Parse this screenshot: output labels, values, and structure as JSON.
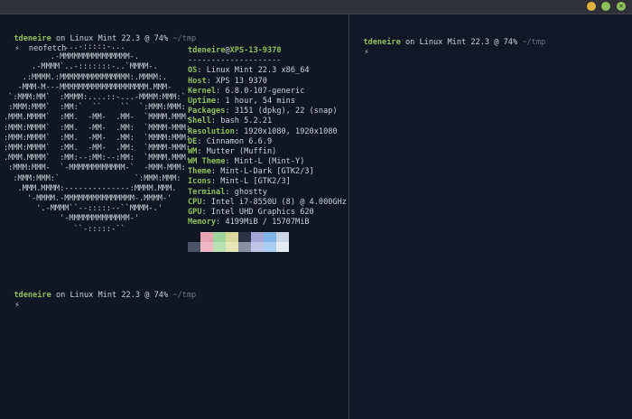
{
  "window": {
    "title": "",
    "controls": {
      "minimize": "",
      "maximize": "",
      "close": "✕"
    }
  },
  "left_pane": {
    "prompt1": {
      "user": "tdeneire",
      "on": " on ",
      "host": "Linux Mint 22.3",
      "at": " @ ",
      "battery": "74%",
      "path": " ~/tmp"
    },
    "command1": {
      "bolt": "⚡",
      "command": "neofetch"
    },
    "prompt2": {
      "user": "tdeneire",
      "on": " on ",
      "host": "Linux Mint 22.3",
      "at": " @ ",
      "battery": "74%",
      "path": " ~/tmp"
    },
    "command2": {
      "bolt": "⚡"
    }
  },
  "right_pane": {
    "prompt": {
      "user": "tdeneire",
      "on": " on ",
      "host": "Linux Mint 22.3",
      "at": " @ ",
      "battery": "74%",
      "path": " ~/tmp"
    },
    "command": {
      "bolt": "⚡"
    }
  },
  "neofetch": {
    "ascii_art": [
      "             ...-:::::-...",
      "          .-MMMMMMMMMMMMMMM-.",
      "      .-MMMM`..-:::::::-..`MMMM-.",
      "    .:MMMM.:MMMMMMMMMMMMMMM:.MMMM:.",
      "   -MMM-M---MMMMMMMMMMMMMMMMMMM.MMM-",
      " `:MMM:MM`  :MMMM:....::-...-MMMM:MMM:`",
      " :MMM:MMM`  :MM:`  ``    ``  `:MMM:MMM:",
      ".MMM.MMMM`  :MM.  -MM-  .MM-  `MMMM.MMM.",
      ":MMM:MMMM`  :MM.  -MM-  .MM:  `MMMM-MMM:",
      ":MMM:MMMM`  :MM.  -MM-  .MM:  `MMMM:MMM:",
      ":MMM:MMMM`  :MM.  -MM-  .MM:  `MMMM-MMM:",
      ".MMM.MMMM`  :MM:--:MM:--:MM:  `MMMM.MMM.",
      " :MMM:MMM-  `-MMMMMMMMMMMM-`  -MMM-MMM:",
      "  :MMM:MMM:`                `:MMM:MMM:",
      "   .MMM.MMMM:--------------:MMMM.MMM.",
      "     '-MMMM.-MMMMMMMMMMMMMMM-.MMMM-'",
      "       '.-MMMM``--:::::--``MMMM-.'",
      "            '-MMMMMMMMMMMMM-'",
      "               ``-:::::-``"
    ],
    "header": {
      "user": "tdeneire",
      "at": "@",
      "host": "XPS-13-9370",
      "separator": "--------------------"
    },
    "fields": [
      {
        "key": "OS",
        "value": "Linux Mint 22.3 x86_64"
      },
      {
        "key": "Host",
        "value": "XPS 13 9370"
      },
      {
        "key": "Kernel",
        "value": "6.8.0-107-generic"
      },
      {
        "key": "Uptime",
        "value": "1 hour, 54 mins"
      },
      {
        "key": "Packages",
        "value": "3151 (dpkg), 22 (snap)"
      },
      {
        "key": "Shell",
        "value": "bash 5.2.21"
      },
      {
        "key": "Resolution",
        "value": "1920x1080, 1920x1080"
      },
      {
        "key": "DE",
        "value": "Cinnamon 6.6.9"
      },
      {
        "key": "WM",
        "value": "Mutter (Muffin)"
      },
      {
        "key": "WM Theme",
        "value": "Mint-L (Mint-Y)"
      },
      {
        "key": "Theme",
        "value": "Mint-L-Dark [GTK2/3]"
      },
      {
        "key": "Icons",
        "value": "Mint-L [GTK2/3]"
      },
      {
        "key": "Terminal",
        "value": "ghostty"
      },
      {
        "key": "CPU",
        "value": "Intel i7-8550U (8) @ 4.000GHz"
      },
      {
        "key": "GPU",
        "value": "Intel UHD Graphics 620"
      },
      {
        "key": "Memory",
        "value": "4199MiB / 15707MiB"
      }
    ],
    "palette": {
      "row1": [
        "#0f1724",
        "#e6a4b4",
        "#9ed39a",
        "#d9d79a",
        "#2c3445",
        "#a3a6d6",
        "#7fb4e6",
        "#c9d4e4"
      ],
      "row2": [
        "#4a5568",
        "#f0b7c6",
        "#b7e3b2",
        "#e6e5b5",
        "#8791a3",
        "#c0c2e6",
        "#a7cdf0",
        "#e6ebf2"
      ]
    }
  }
}
